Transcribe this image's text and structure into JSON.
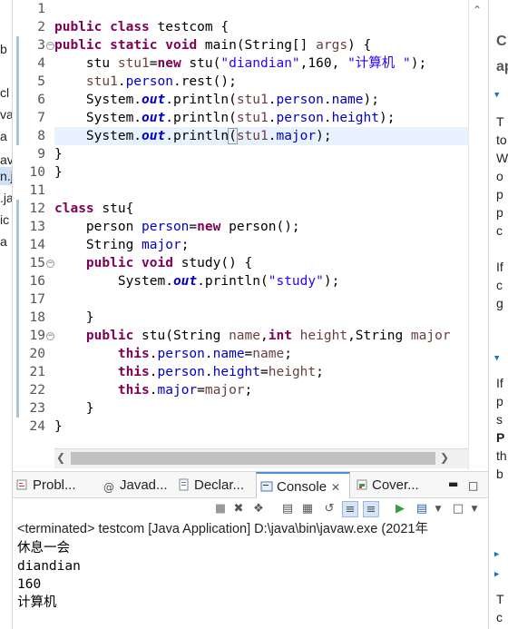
{
  "package_explorer": {
    "fragments": [
      "b",
      "cl",
      "va",
      "a",
      "av",
      "n.j",
      ".ja",
      "ic",
      "a"
    ]
  },
  "editor": {
    "lines": [
      {
        "n": "1",
        "tokens": []
      },
      {
        "n": "2",
        "tokens": [
          [
            "kw",
            "public"
          ],
          [
            "t",
            " "
          ],
          [
            "kw",
            "class"
          ],
          [
            "t",
            " testcom {"
          ]
        ]
      },
      {
        "n": "3",
        "tokens": [
          [
            "kw",
            "public"
          ],
          [
            "t",
            " "
          ],
          [
            "kw",
            "static"
          ],
          [
            "t",
            " "
          ],
          [
            "kw",
            "void"
          ],
          [
            "t",
            " main(String[] "
          ],
          [
            "par",
            "args"
          ],
          [
            "t",
            ") {"
          ]
        ]
      },
      {
        "n": "4",
        "tokens": [
          [
            "t",
            "    stu "
          ],
          [
            "par",
            "stu1"
          ],
          [
            "t",
            "="
          ],
          [
            "kw",
            "new"
          ],
          [
            "t",
            " stu("
          ],
          [
            "str",
            "\"diandian\""
          ],
          [
            "t",
            ",160, "
          ],
          [
            "str",
            "\"计算机 \""
          ],
          [
            "t",
            ");"
          ]
        ]
      },
      {
        "n": "5",
        "tokens": [
          [
            "t",
            "    "
          ],
          [
            "par",
            "stu1"
          ],
          [
            "t",
            "."
          ],
          [
            "fld",
            "person"
          ],
          [
            "t",
            ".rest();"
          ]
        ]
      },
      {
        "n": "6",
        "tokens": [
          [
            "t",
            "    System."
          ],
          [
            "sf",
            "out"
          ],
          [
            "t",
            ".println("
          ],
          [
            "par",
            "stu1"
          ],
          [
            "t",
            "."
          ],
          [
            "fld",
            "person"
          ],
          [
            "t",
            "."
          ],
          [
            "fld",
            "name"
          ],
          [
            "t",
            ");"
          ]
        ]
      },
      {
        "n": "7",
        "tokens": [
          [
            "t",
            "    System."
          ],
          [
            "sf",
            "out"
          ],
          [
            "t",
            ".println("
          ],
          [
            "par",
            "stu1"
          ],
          [
            "t",
            "."
          ],
          [
            "fld",
            "person"
          ],
          [
            "t",
            "."
          ],
          [
            "fld",
            "height"
          ],
          [
            "t",
            ");"
          ]
        ]
      },
      {
        "n": "8",
        "tokens": [
          [
            "t",
            "    System."
          ],
          [
            "sf",
            "out"
          ],
          [
            "t",
            ".println"
          ],
          [
            "bm",
            "("
          ],
          [
            "par",
            "stu1"
          ],
          [
            "t",
            "."
          ],
          [
            "fld",
            "major"
          ],
          [
            "t",
            ");"
          ]
        ]
      },
      {
        "n": "9",
        "tokens": [
          [
            "t",
            "}"
          ]
        ]
      },
      {
        "n": "10",
        "tokens": [
          [
            "t",
            "}"
          ]
        ]
      },
      {
        "n": "11",
        "tokens": []
      },
      {
        "n": "12",
        "tokens": [
          [
            "kw",
            "class"
          ],
          [
            "t",
            " stu{"
          ]
        ]
      },
      {
        "n": "13",
        "tokens": [
          [
            "t",
            "    person "
          ],
          [
            "fld",
            "person"
          ],
          [
            "t",
            "="
          ],
          [
            "kw",
            "new"
          ],
          [
            "t",
            " person();"
          ]
        ]
      },
      {
        "n": "14",
        "tokens": [
          [
            "t",
            "    String "
          ],
          [
            "fld",
            "major"
          ],
          [
            "t",
            ";"
          ]
        ]
      },
      {
        "n": "15",
        "tokens": [
          [
            "t",
            "    "
          ],
          [
            "kw",
            "public"
          ],
          [
            "t",
            " "
          ],
          [
            "kw",
            "void"
          ],
          [
            "t",
            " study() {"
          ]
        ]
      },
      {
        "n": "16",
        "tokens": [
          [
            "t",
            "        System."
          ],
          [
            "sf",
            "out"
          ],
          [
            "t",
            ".println("
          ],
          [
            "str",
            "\"study\""
          ],
          [
            "t",
            ");"
          ]
        ]
      },
      {
        "n": "17",
        "tokens": []
      },
      {
        "n": "18",
        "tokens": [
          [
            "t",
            "    }"
          ]
        ]
      },
      {
        "n": "19",
        "tokens": [
          [
            "t",
            "    "
          ],
          [
            "kw",
            "public"
          ],
          [
            "t",
            " stu(String "
          ],
          [
            "par",
            "name"
          ],
          [
            "t",
            ","
          ],
          [
            "kw",
            "int"
          ],
          [
            "t",
            " "
          ],
          [
            "par",
            "height"
          ],
          [
            "t",
            ",String "
          ],
          [
            "par",
            "major"
          ]
        ]
      },
      {
        "n": "20",
        "tokens": [
          [
            "t",
            "        "
          ],
          [
            "kw",
            "this"
          ],
          [
            "t",
            "."
          ],
          [
            "fld",
            "person"
          ],
          [
            "t",
            "."
          ],
          [
            "fld",
            "name"
          ],
          [
            "t",
            "="
          ],
          [
            "par",
            "name"
          ],
          [
            "t",
            ";"
          ]
        ]
      },
      {
        "n": "21",
        "tokens": [
          [
            "t",
            "        "
          ],
          [
            "kw",
            "this"
          ],
          [
            "t",
            "."
          ],
          [
            "fld",
            "person"
          ],
          [
            "t",
            "."
          ],
          [
            "fld",
            "height"
          ],
          [
            "t",
            "="
          ],
          [
            "par",
            "height"
          ],
          [
            "t",
            ";"
          ]
        ]
      },
      {
        "n": "22",
        "tokens": [
          [
            "t",
            "        "
          ],
          [
            "kw",
            "this"
          ],
          [
            "t",
            "."
          ],
          [
            "fld",
            "major"
          ],
          [
            "t",
            "="
          ],
          [
            "par",
            "major"
          ],
          [
            "t",
            ";"
          ]
        ]
      },
      {
        "n": "23",
        "tokens": [
          [
            "t",
            "    }"
          ]
        ]
      },
      {
        "n": "24",
        "tokens": [
          [
            "t",
            "}"
          ]
        ]
      }
    ],
    "folded_lines": [
      "3",
      "15",
      "19"
    ],
    "current_line": "8"
  },
  "right_panel": {
    "fragments": [
      "C",
      "ap",
      "T",
      "to",
      "W",
      "o",
      "p",
      "p",
      "c",
      "If",
      "c",
      "g",
      "If",
      "p",
      "s",
      "P",
      "th",
      "b",
      "T",
      "c"
    ]
  },
  "console": {
    "tabs": [
      {
        "label": "Probl...",
        "icon": "problems-icon"
      },
      {
        "label": "Javad...",
        "icon": "javadoc-icon"
      },
      {
        "label": "Declar...",
        "icon": "declaration-icon"
      },
      {
        "label": "Console",
        "icon": "console-icon",
        "active": true
      },
      {
        "label": "Cover...",
        "icon": "coverage-icon"
      }
    ],
    "header": "<terminated> testcom [Java Application] D:\\java\\bin\\javaw.exe  (2021年",
    "output": [
      "休息一会",
      "diandian",
      "160",
      "计算机"
    ]
  }
}
